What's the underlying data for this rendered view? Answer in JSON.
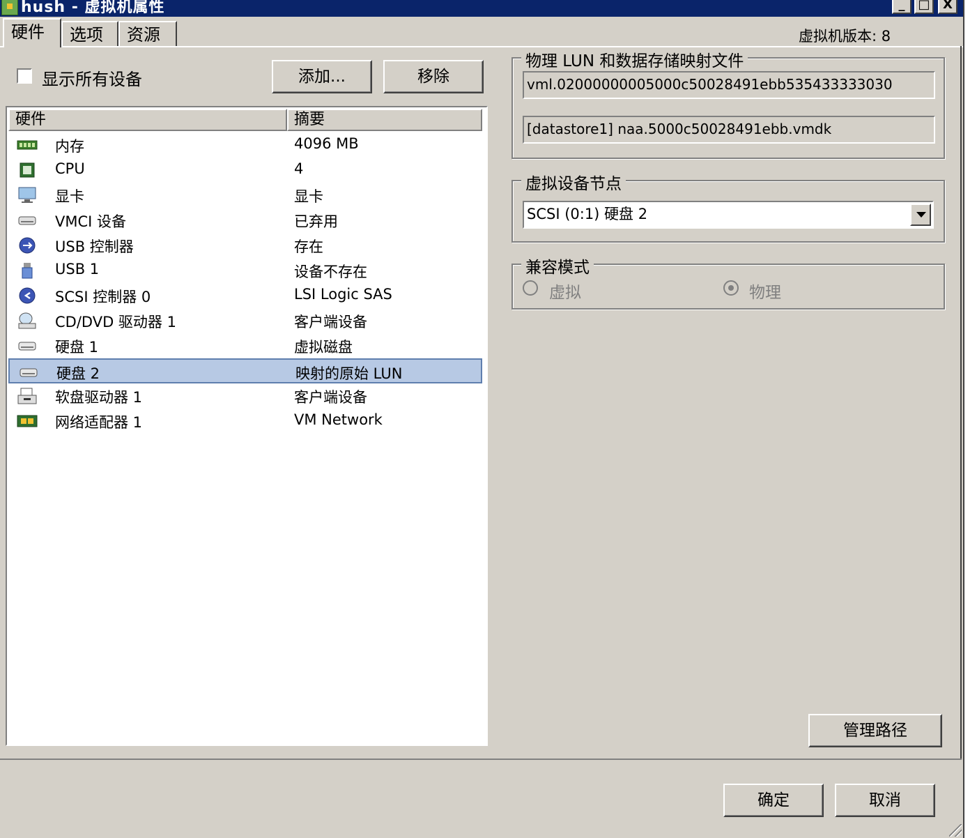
{
  "window": {
    "title": "hush - 虚拟机属性",
    "controls": [
      "_",
      "□",
      "X"
    ]
  },
  "tabs": [
    "硬件",
    "选项",
    "资源"
  ],
  "vm_version": "虚拟机版本: 8",
  "show_all_devices_label": "显示所有设备",
  "buttons": {
    "add": "添加...",
    "remove": "移除",
    "manage_paths": "管理路径",
    "ok": "确定",
    "cancel": "取消"
  },
  "hardware_list": {
    "headers": [
      "硬件",
      "摘要"
    ],
    "rows": [
      {
        "icon": "memory-icon",
        "name": "内存",
        "summary": "4096 MB"
      },
      {
        "icon": "cpu-icon",
        "name": "CPU",
        "summary": "4"
      },
      {
        "icon": "display-icon",
        "name": "显卡",
        "summary": "显卡"
      },
      {
        "icon": "vmci-device-icon",
        "name": "VMCI 设备",
        "summary": "已弃用"
      },
      {
        "icon": "usb-controller-icon",
        "name": "USB 控制器",
        "summary": "存在"
      },
      {
        "icon": "usb-device-icon",
        "name": "USB 1",
        "summary": "设备不存在"
      },
      {
        "icon": "scsi-controller-icon",
        "name": "SCSI 控制器 0",
        "summary": "LSI Logic SAS"
      },
      {
        "icon": "cd-dvd-icon",
        "name": "CD/DVD 驱动器 1",
        "summary": "客户端设备"
      },
      {
        "icon": "hard-disk-icon",
        "name": "硬盘 1",
        "summary": "虚拟磁盘"
      },
      {
        "icon": "hard-disk-icon",
        "name": "硬盘 2",
        "summary": "映射的原始 LUN",
        "selected": true
      },
      {
        "icon": "floppy-icon",
        "name": "软盘驱动器 1",
        "summary": "客户端设备"
      },
      {
        "icon": "network-adapter-icon",
        "name": "网络适配器 1",
        "summary": "VM Network"
      }
    ]
  },
  "lun_group": {
    "legend": "物理 LUN 和数据存储映射文件",
    "lun_id": "vml.02000000005000c50028491ebb535433333030",
    "mapping_file": "[datastore1] naa.5000c50028491ebb.vmdk"
  },
  "device_node_group": {
    "legend": "虚拟设备节点",
    "selected": "SCSI (0:1) 硬盘 2"
  },
  "compat_group": {
    "legend": "兼容模式",
    "options": [
      "虚拟",
      "物理"
    ],
    "selected": "物理"
  }
}
